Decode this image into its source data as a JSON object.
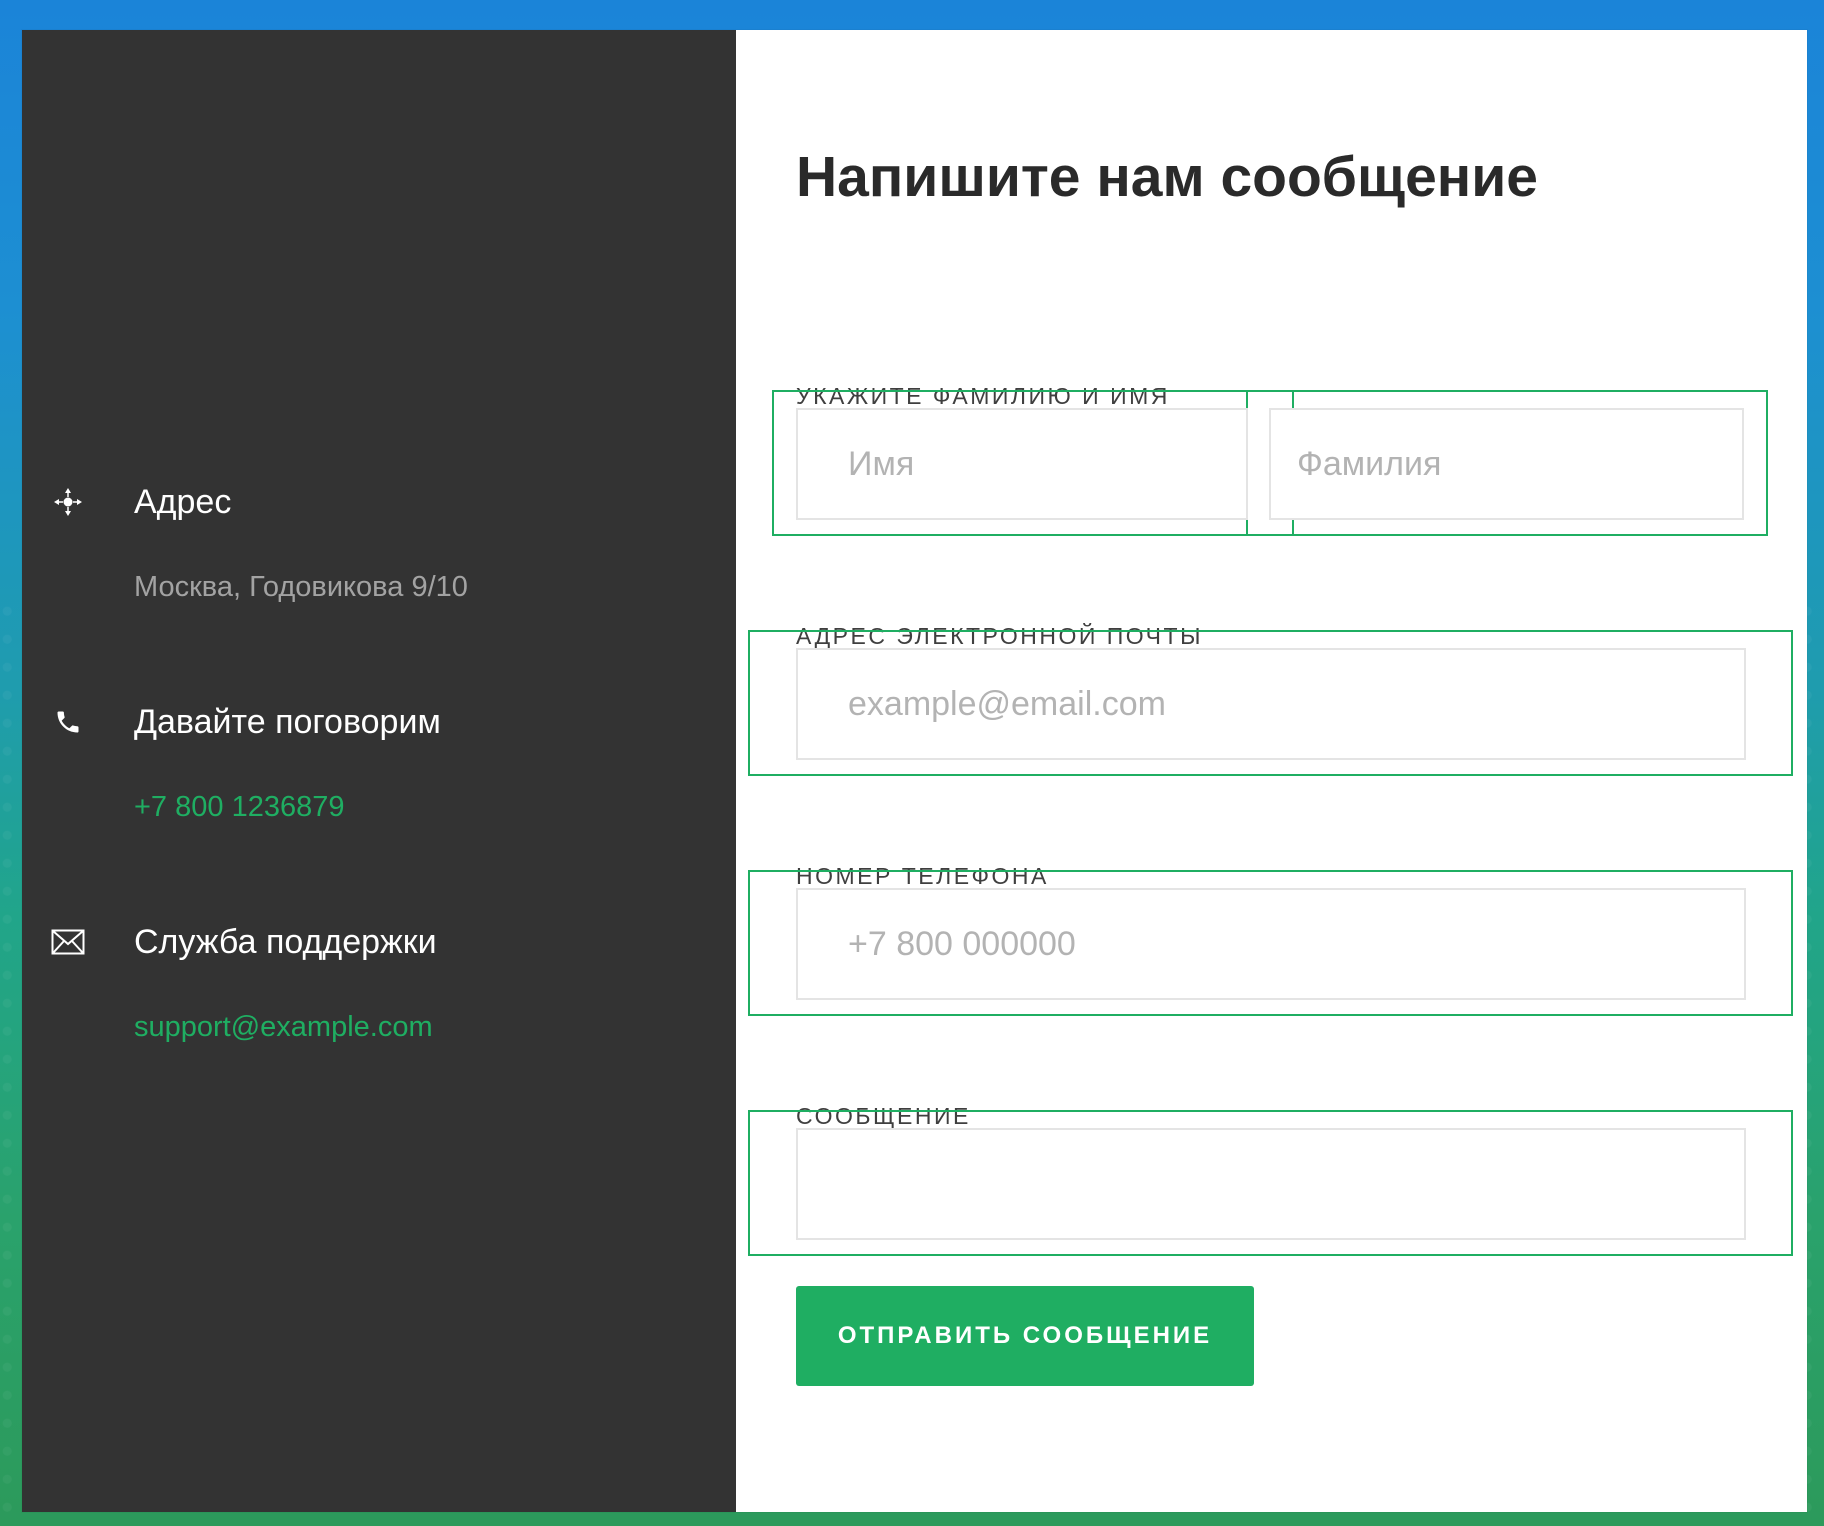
{
  "contact_info": {
    "items": [
      {
        "icon": "location-icon",
        "title": "Адрес",
        "value": "Москва, Годовикова 9/10",
        "value_style": "muted"
      },
      {
        "icon": "phone-icon",
        "title": "Давайте поговорим",
        "value": "+7 800 1236879",
        "value_style": "green"
      },
      {
        "icon": "envelope-icon",
        "title": "Служба поддержки",
        "value": "support@example.com",
        "value_style": "green"
      }
    ]
  },
  "form": {
    "title": "Напишите нам сообщение",
    "name_label": "УКАЖИТЕ ФАМИЛИЮ И ИМЯ",
    "first_name_placeholder": "Имя",
    "last_name_placeholder": "Фамилия",
    "email_label": "АДРЕС ЭЛЕКТРОННОЙ ПОЧТЫ",
    "email_placeholder": "example@email.com",
    "phone_label": "НОМЕР ТЕЛЕФОНА",
    "phone_placeholder": "+7 800 000000",
    "message_label": "СООБЩЕНИЕ",
    "message_placeholder": "",
    "submit_label": "ОТПРАВИТЬ СООБЩЕНИЕ"
  },
  "colors": {
    "accent": "#1fae62",
    "sidebar_bg": "#333333",
    "panel_bg": "#ffffff"
  }
}
